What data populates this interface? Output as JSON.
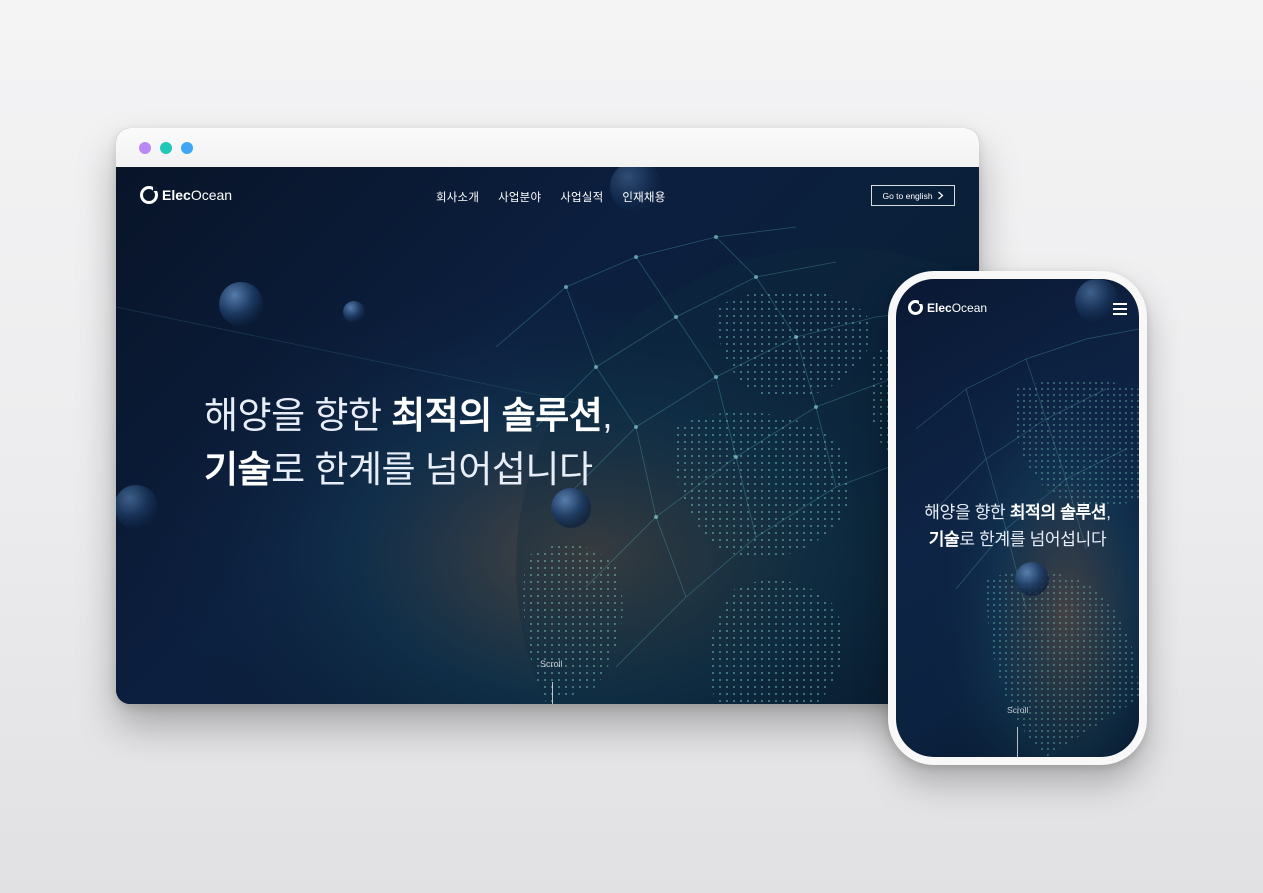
{
  "browser": {
    "dots": [
      "#b889f5",
      "#22c7b8",
      "#3ea6f2"
    ]
  },
  "desktop": {
    "logo": {
      "bold": "Elec",
      "light": "Ocean"
    },
    "nav": [
      "회사소개",
      "사업분야",
      "사업실적",
      "인재채용"
    ],
    "lang_button": {
      "label": "Go to english",
      "icon": "chevron-right-icon"
    },
    "hero": {
      "line1_normal": "해양을 향한 ",
      "line1_bold": "최적의 솔루션",
      "line1_comma": ",",
      "line2_bold": "기술",
      "line2_normal": "로 한계를 넘어섭니다"
    },
    "scroll_label": "Scroll"
  },
  "mobile": {
    "logo": {
      "bold": "Elec",
      "light": "Ocean"
    },
    "menu_icon": "hamburger-icon",
    "hero": {
      "line1_normal": "해양을 향한 ",
      "line1_bold": "최적의 솔루션",
      "line1_comma": ",",
      "line2_bold": "기술",
      "line2_normal": "로 한계를 넘어섭니다"
    },
    "scroll_label": "Scroll"
  }
}
